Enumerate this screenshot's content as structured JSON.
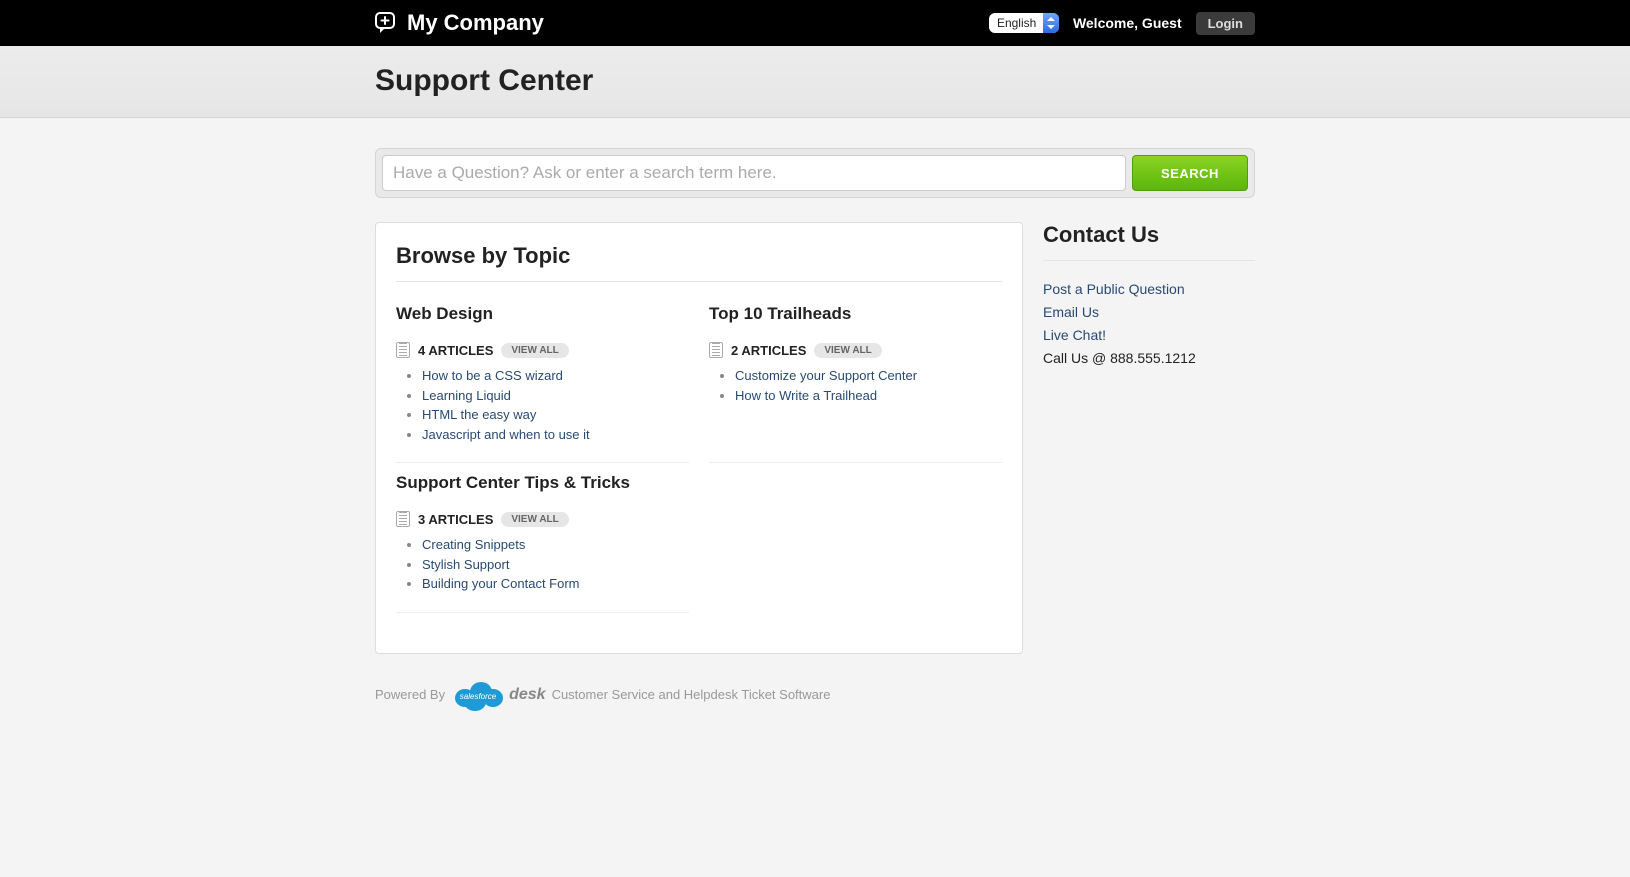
{
  "topbar": {
    "company": "My Company",
    "language_selected": "English",
    "welcome": "Welcome, Guest",
    "login": "Login"
  },
  "page_title": "Support Center",
  "search": {
    "placeholder": "Have a Question? Ask or enter a search term here.",
    "button": "SEARCH"
  },
  "browse_heading": "Browse by Topic",
  "topics": [
    {
      "title": "Web Design",
      "count_label": "4 ARTICLES",
      "view_all": "VIEW ALL",
      "links": [
        "How to be a CSS wizard",
        "Learning Liquid",
        "HTML the easy way",
        "Javascript and when to use it"
      ]
    },
    {
      "title": "Top 10 Trailheads",
      "count_label": "2 ARTICLES",
      "view_all": "VIEW ALL",
      "links": [
        "Customize your Support Center",
        "How to Write a Trailhead"
      ]
    },
    {
      "title": "Support Center Tips & Tricks",
      "count_label": "3 ARTICLES",
      "view_all": "VIEW ALL",
      "links": [
        "Creating Snippets",
        "Stylish Support",
        "Building your Contact Form"
      ]
    }
  ],
  "contact": {
    "heading": "Contact Us",
    "links": [
      "Post a Public Question",
      "Email Us",
      "Live Chat!"
    ],
    "call_us": "Call Us @ 888.555.1212"
  },
  "footer": {
    "powered_by": "Powered By",
    "cloud_text": "salesforce",
    "desk": "desk",
    "tail": "Customer Service and Helpdesk Ticket Software"
  }
}
